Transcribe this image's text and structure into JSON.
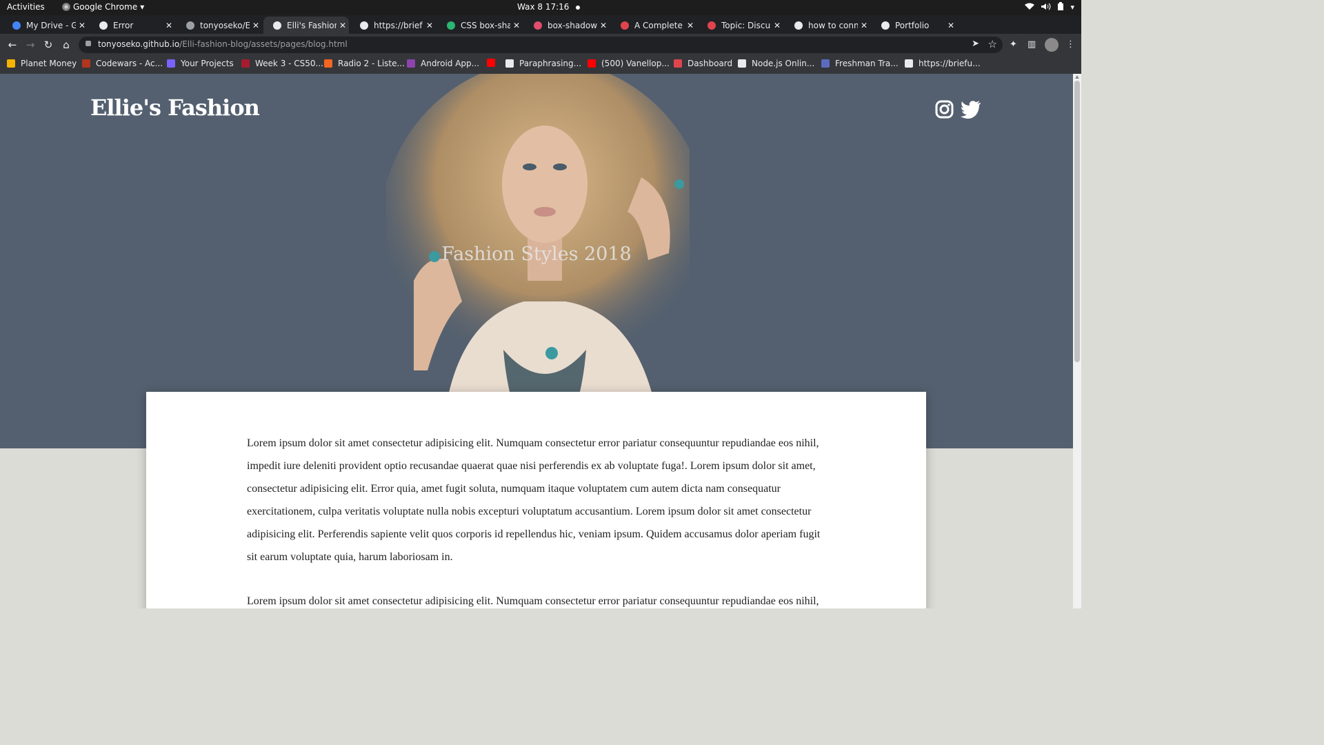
{
  "os_bar": {
    "activities": "Activities",
    "app_name": "Google Chrome",
    "clock": "Wax 8  17:16"
  },
  "tabs": [
    {
      "label": "My Drive - Go",
      "icon": "google-drive-icon",
      "color": "#4285f4"
    },
    {
      "label": "Error",
      "icon": "globe-icon",
      "color": "#e8eaed"
    },
    {
      "label": "tonyoseko/El",
      "icon": "github-icon",
      "color": "#9aa0a6"
    },
    {
      "label": "Elli's Fashion",
      "icon": "globe-icon",
      "color": "#e8eaed",
      "active": true
    },
    {
      "label": "https://brief",
      "icon": "globe-icon",
      "color": "#e8eaed"
    },
    {
      "label": "CSS box-shac",
      "icon": "w3-icon",
      "color": "#2bb673"
    },
    {
      "label": "box-shadow",
      "icon": "asterisk-icon",
      "color": "#e04e6c"
    },
    {
      "label": "A Complete G",
      "icon": "asterisk-icon",
      "color": "#e0444e"
    },
    {
      "label": "Topic: Discus",
      "icon": "ring-icon",
      "color": "#e0444e"
    },
    {
      "label": "how to conne",
      "icon": "google-icon",
      "color": "#e8eaed"
    },
    {
      "label": "Portfolio",
      "icon": "globe-icon",
      "color": "#e8eaed"
    }
  ],
  "address_bar": {
    "host": "tonyoseko.github.io",
    "path": "/Elli-fashion-blog/assets/pages/blog.html"
  },
  "bookmarks": [
    {
      "label": "Planet Money",
      "icon": "podcast-icon",
      "color": "#f4b400"
    },
    {
      "label": "Codewars - Ac...",
      "icon": "codewars-icon",
      "color": "#b1361e"
    },
    {
      "label": "Your Projects",
      "icon": "projects-icon",
      "color": "#7b61ff"
    },
    {
      "label": "Week 3 - CS50...",
      "icon": "cs50-icon",
      "color": "#a51c30"
    },
    {
      "label": "Radio 2 - Liste...",
      "icon": "radio-icon",
      "color": "#f26522"
    },
    {
      "label": "Android App...",
      "icon": "udacity-icon",
      "color": "#8e44ad"
    },
    {
      "label": "",
      "icon": "youtube-icon",
      "color": "#ff0000"
    },
    {
      "label": "Paraphrasing...",
      "icon": "quill-icon",
      "color": "#e8eaed"
    },
    {
      "label": "(500) Vanellop...",
      "icon": "youtube-icon",
      "color": "#ff0000"
    },
    {
      "label": "Dashboard",
      "icon": "ring-icon",
      "color": "#e0444e"
    },
    {
      "label": "Node.js Onlin...",
      "icon": "node-icon",
      "color": "#e8eaed"
    },
    {
      "label": "Freshman Tra...",
      "icon": "diamond-icon",
      "color": "#5c6bc0"
    },
    {
      "label": "https://briefu...",
      "icon": "globe-icon",
      "color": "#e8eaed"
    }
  ],
  "site": {
    "title": "Ellie's Fashion",
    "hero_heading": "Fashion Styles 2018",
    "paragraphs": [
      "Lorem ipsum dolor sit amet consectetur adipisicing elit. Numquam consectetur error pariatur consequuntur repudiandae eos nihil, impedit iure deleniti provident optio recusandae quaerat quae nisi perferendis ex ab voluptate fuga!. Lorem ipsum dolor sit amet, consectetur adipisicing elit. Error quia, amet fugit soluta, numquam itaque voluptatem cum autem dicta nam consequatur exercitationem, culpa veritatis voluptate nulla nobis excepturi voluptatum accusantium. Lorem ipsum dolor sit amet consectetur adipisicing elit. Perferendis sapiente velit quos corporis id repellendus hic, veniam ipsum. Quidem accusamus dolor aperiam fugit sit earum voluptate quia, harum laboriosam in.",
      "Lorem ipsum dolor sit amet consectetur adipisicing elit. Numquam consectetur error pariatur consequuntur repudiandae eos nihil,"
    ],
    "social": [
      "instagram-icon",
      "twitter-icon"
    ]
  }
}
